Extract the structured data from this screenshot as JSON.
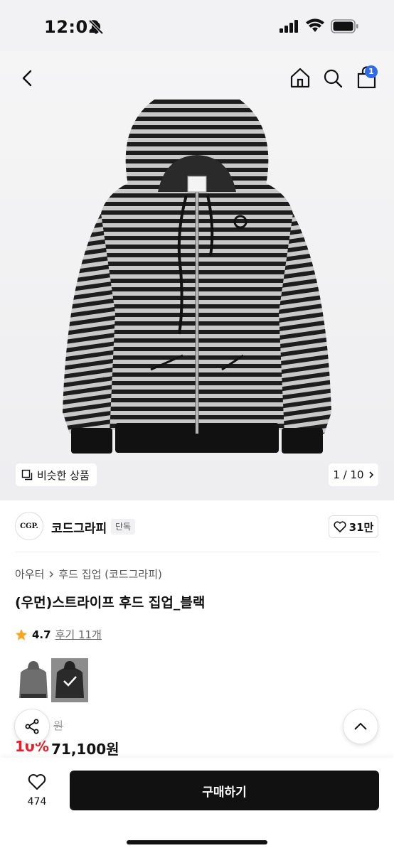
{
  "status": {
    "time": "12:02"
  },
  "nav": {
    "cart_count": "1"
  },
  "image": {
    "similar_label": "비슷한 상품",
    "page_counter": "1 / 10"
  },
  "brand": {
    "logo_text": "CGP.",
    "name": "코드그라피",
    "tag": "단독",
    "likes": "31만"
  },
  "breadcrumb": {
    "category": "아우터",
    "sub": "후드 집업 (코드그라피)"
  },
  "product": {
    "title": "(우먼)스트라이프 후드 집업_블랙",
    "rating": "4.7",
    "reviews": "후기 11개",
    "original_price": "원",
    "discount": "10%",
    "price": "71,100원"
  },
  "bottom": {
    "wish_count": "474",
    "buy_label": "구매하기"
  },
  "colors": {
    "accent_red": "#e8202a",
    "badge_blue": "#2f6be6",
    "star": "#f5a623"
  }
}
